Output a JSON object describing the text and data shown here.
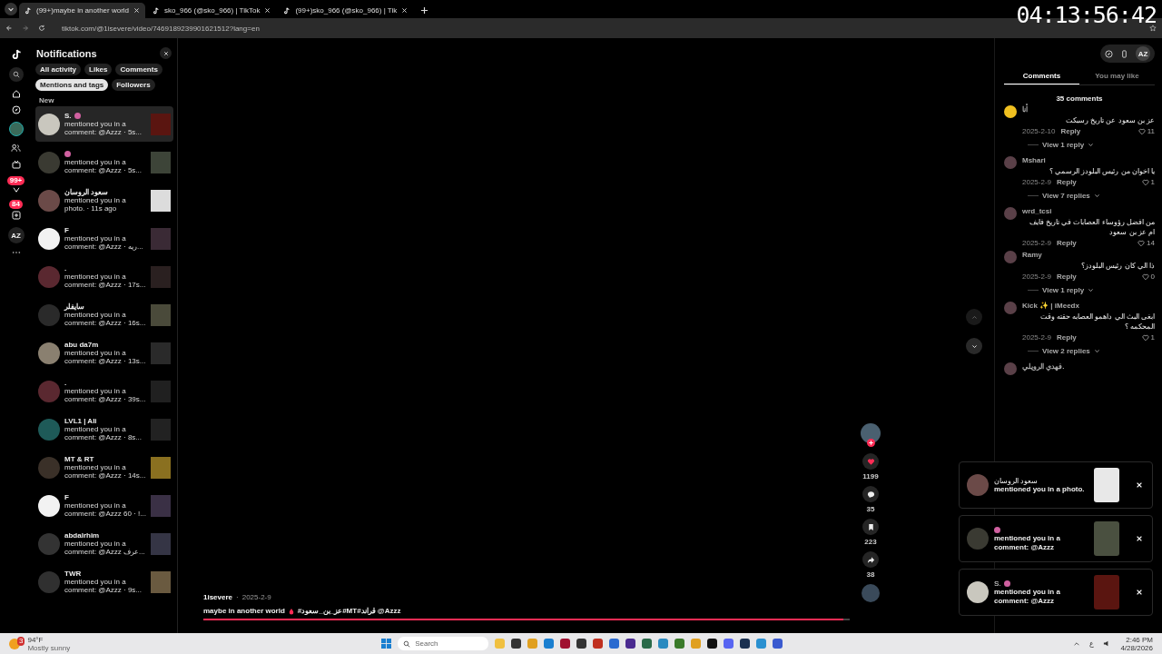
{
  "browser": {
    "tabs": [
      {
        "title": "(99+)maybe in another world",
        "selected": true
      },
      {
        "title": "sko_966 (@sko_966) | TikTok",
        "selected": false
      },
      {
        "title": "(99+)sko_966 (@sko_966) | Tik",
        "selected": false
      }
    ],
    "address": "tiktok.com/@1isevere/video/7469189239901621512?lang=en"
  },
  "recording_timer": "04:13:56:42",
  "nav": {
    "badges": [
      {
        "text": "99+"
      },
      {
        "text": "84"
      }
    ],
    "profile": "AZ"
  },
  "notifications": {
    "title": "Notifications",
    "filters": [
      {
        "label": "All activity",
        "selected": false
      },
      {
        "label": "Likes",
        "selected": false
      },
      {
        "label": "Comments",
        "selected": false
      },
      {
        "label": "Mentions and tags",
        "selected": true
      },
      {
        "label": "Followers",
        "selected": false
      }
    ],
    "section": "New",
    "items": [
      {
        "name": "S.",
        "emoji": true,
        "line1": "mentioned you in a",
        "line2": "comment: @Azzz · 5s...",
        "selected": true
      },
      {
        "emoji": true,
        "line1": "mentioned you in a",
        "line2": "comment: @Azzz · 5s...",
        "selected": false
      },
      {
        "name": "سعود الروسان",
        "emoji": false,
        "line1": "mentioned you in a",
        "line2": "photo. · 11s ago",
        "selected": false
      },
      {
        "name": "F",
        "emoji": false,
        "line1": "mentioned you in a",
        "line2": "comment: @Azzz · ريه...",
        "selected": false
      },
      {
        "name": ".",
        "emoji": false,
        "line1": "mentioned you in a",
        "line2": "comment: @Azzz · 17s...",
        "selected": false
      },
      {
        "name": "سايفلر",
        "emoji": false,
        "line1": "mentioned you in a",
        "line2": "comment: @Azzz · 16s...",
        "selected": false
      },
      {
        "name": "abu da7m",
        "emoji": false,
        "line1": "mentioned you in a",
        "line2": "comment: @Azzz · 13s...",
        "selected": false
      },
      {
        "name": ".",
        "emoji": false,
        "line1": "mentioned you in a",
        "line2": "comment: @Azzz · 39s...",
        "selected": false
      },
      {
        "name": "LVL1 | Ali",
        "emoji": false,
        "line1": "mentioned you in a",
        "line2": "comment: @Azzz · 8s...",
        "selected": false
      },
      {
        "name": "MT & RT",
        "emoji": false,
        "line1": "mentioned you in a",
        "line2": "comment: @Azzz · 14s...",
        "selected": false
      },
      {
        "name": "F",
        "emoji": false,
        "line1": "mentioned you in a",
        "line2": "comment: @Azzz 60 · !...",
        "selected": false
      },
      {
        "name": "abdalrhim",
        "emoji": false,
        "line1": "mentioned you in a",
        "line2": "comment: @Azzz عرف...",
        "selected": false
      },
      {
        "name": "TWR",
        "emoji": false,
        "line1": "mentioned you in a",
        "line2": "comment: @Azzz · 9s...",
        "selected": false
      }
    ]
  },
  "video": {
    "author": "1isevere",
    "separator": "·",
    "date": "2025-2-9",
    "caption_start": "maybe in another world",
    "caption_end": "#عز_بن_سعود#MT#قراند @Azzz",
    "progress": {
      "level": 0.99
    },
    "actions": [
      {
        "kind": "like",
        "count": "1199"
      },
      {
        "kind": "comment",
        "count": "35"
      },
      {
        "kind": "save",
        "count": "223"
      },
      {
        "kind": "share",
        "count": "38"
      }
    ]
  },
  "comments_panel": {
    "profile": "AZ",
    "tabs": [
      {
        "label": "Comments",
        "selected": true
      },
      {
        "label": "You may like",
        "selected": false
      }
    ],
    "count": "35 comments",
    "comments": [
      {
        "user": "أنا",
        "text": "عز بن سعود عن تاريخ رسبكت",
        "date": "2025-2-10",
        "reply": "Reply",
        "likes": "11",
        "replies": "View 1 reply"
      },
      {
        "user": "Mshari",
        "text": "يا اخوان من رئيس البلودز الرسمي ؟",
        "date": "2025-2-9",
        "reply": "Reply",
        "likes": "1",
        "replies": "View 7 replies"
      },
      {
        "user": "wrd_tcsi",
        "text": "من افضل رؤوساء العصابات في تاريخ فايف ام عز بن سعود",
        "date": "2025-2-9",
        "reply": "Reply",
        "likes": "14"
      },
      {
        "user": "Ramy",
        "text": "ذا الي كان رئيس البلودز؟",
        "date": "2025-2-9",
        "reply": "Reply",
        "likes": "0",
        "replies": "View 1 reply"
      },
      {
        "user": "Kick ✨ | iMeedx",
        "text": "ابغى البث الي داهمو العصابه حقته وقت المحكمه ؟",
        "date": "2025-2-9",
        "reply": "Reply",
        "likes": "1",
        "replies": "View 2 replies"
      },
      {
        "user": "فهدي الرويلي."
      }
    ]
  },
  "toasts": [
    {
      "name": "سعود الروسان",
      "emoji": false,
      "line1": "mentioned you in a photo."
    },
    {
      "emoji": true,
      "line1": "mentioned you in a",
      "line2": "comment: @Azzz"
    },
    {
      "name": "S.",
      "emoji": true,
      "line1": "mentioned you in a",
      "line2": "comment: @Azzz"
    }
  ],
  "taskbar": {
    "weather": {
      "temp": "94°F",
      "condition": "Mostly sunny",
      "badge": "3"
    },
    "search_placeholder": "Search",
    "language": "ع",
    "time": "2:46 PM",
    "date": "4/28/2026"
  }
}
